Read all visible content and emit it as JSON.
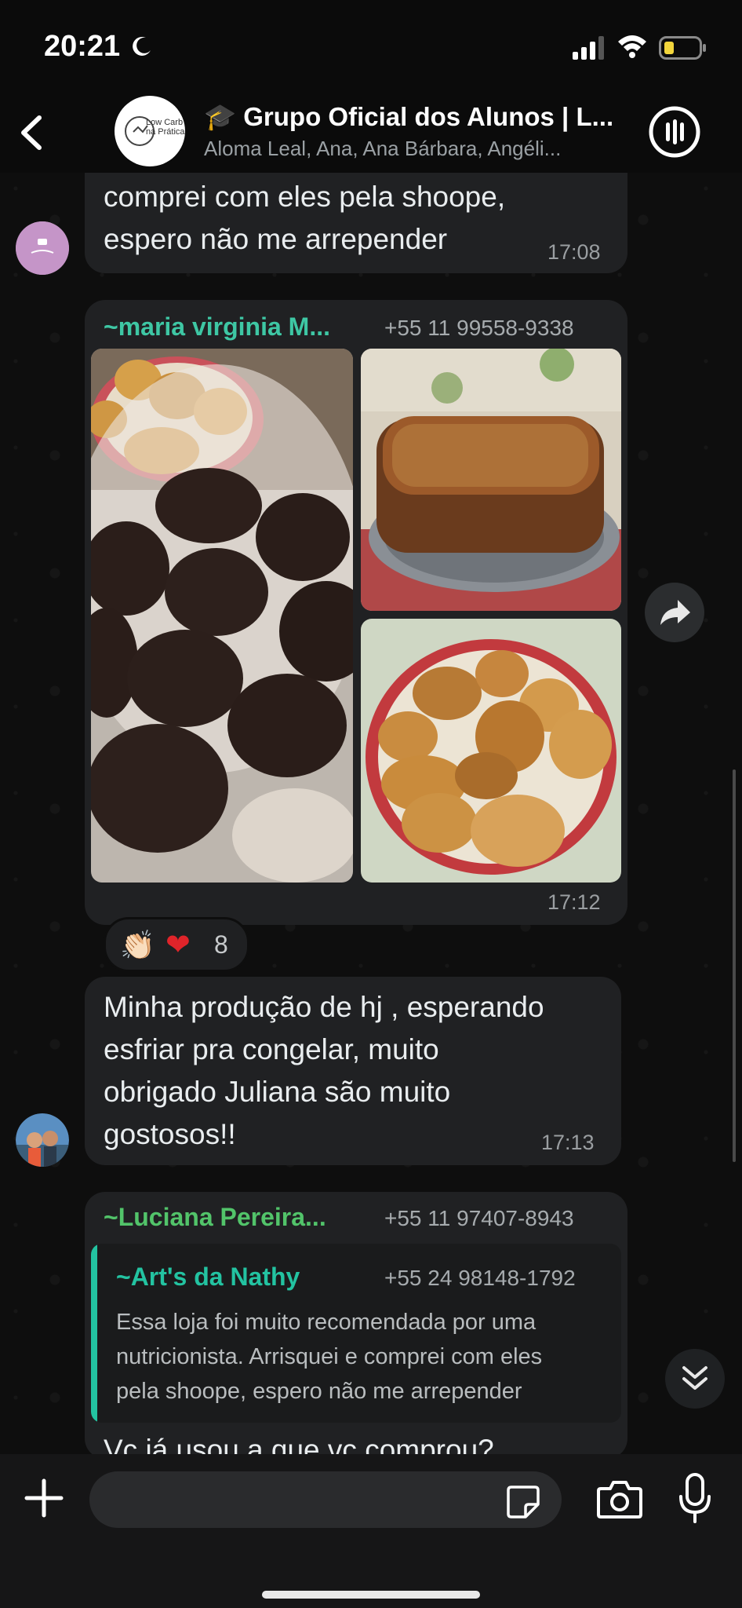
{
  "status": {
    "time": "20:21"
  },
  "header": {
    "title": "🎓 Grupo Oficial dos Alunos | L...",
    "subtitle": "Aloma Leal, Ana, Ana Bárbara, Angéli...",
    "avatar_label": "Low Carb na Prática"
  },
  "messages": [
    {
      "text_line1": "comprei com eles pela shoope,",
      "text_line2": "espero não me arrepender",
      "time": "17:08"
    },
    {
      "sender": "~maria virginia M...",
      "phone": "+55 11 99558-9338",
      "time": "17:12",
      "reactions": {
        "emoji1": "👏🏻",
        "emoji2": "❤",
        "count": "8"
      }
    },
    {
      "text_line1": "Minha produção de hj , esperando",
      "text_line2": "esfriar pra congelar, muito",
      "text_line3": "obrigado Juliana são muito",
      "text_line4": "gostosos!!",
      "time": "17:13"
    },
    {
      "sender": "~Luciana Pereira...",
      "phone": "+55 11 97407-8943",
      "quote": {
        "sender": "~Art's da Nathy",
        "phone": "+55 24 98148-1792",
        "line1": "Essa loja foi muito recomendada por uma",
        "line2": "nutricionista. Arrisquei e comprei com eles",
        "line3": "pela shoope, espero não me arrepender"
      },
      "text_partial": "Vc já usou a que vc comprou?"
    }
  ],
  "colors": {
    "sender_maria": "#3ec7a4",
    "sender_luciana": "#52c46a",
    "quote_accent": "#23c3a1",
    "bubble": "#202123"
  },
  "input": {
    "placeholder": ""
  }
}
